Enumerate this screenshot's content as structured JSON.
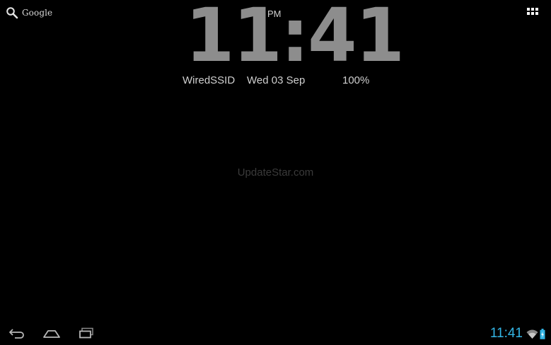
{
  "search": {
    "label": "Google",
    "icon": "search-icon"
  },
  "apps": {
    "icon": "apps-grid-icon"
  },
  "clock": {
    "time": "11:41",
    "ampm": "PM",
    "ssid": "WiredSSID",
    "date": "Wed 03 Sep",
    "battery": "100%",
    "color": "#8d8d8d"
  },
  "watermark": {
    "text": "UpdateStar.com"
  },
  "system_bar": {
    "nav": {
      "back_icon": "back-arrow-icon",
      "home_icon": "home-icon",
      "recents_icon": "recent-apps-icon"
    },
    "status": {
      "time": "11:41",
      "time_color": "#33b5e5",
      "wifi_icon": "wifi-icon",
      "battery_icon": "battery-charging-icon"
    }
  }
}
